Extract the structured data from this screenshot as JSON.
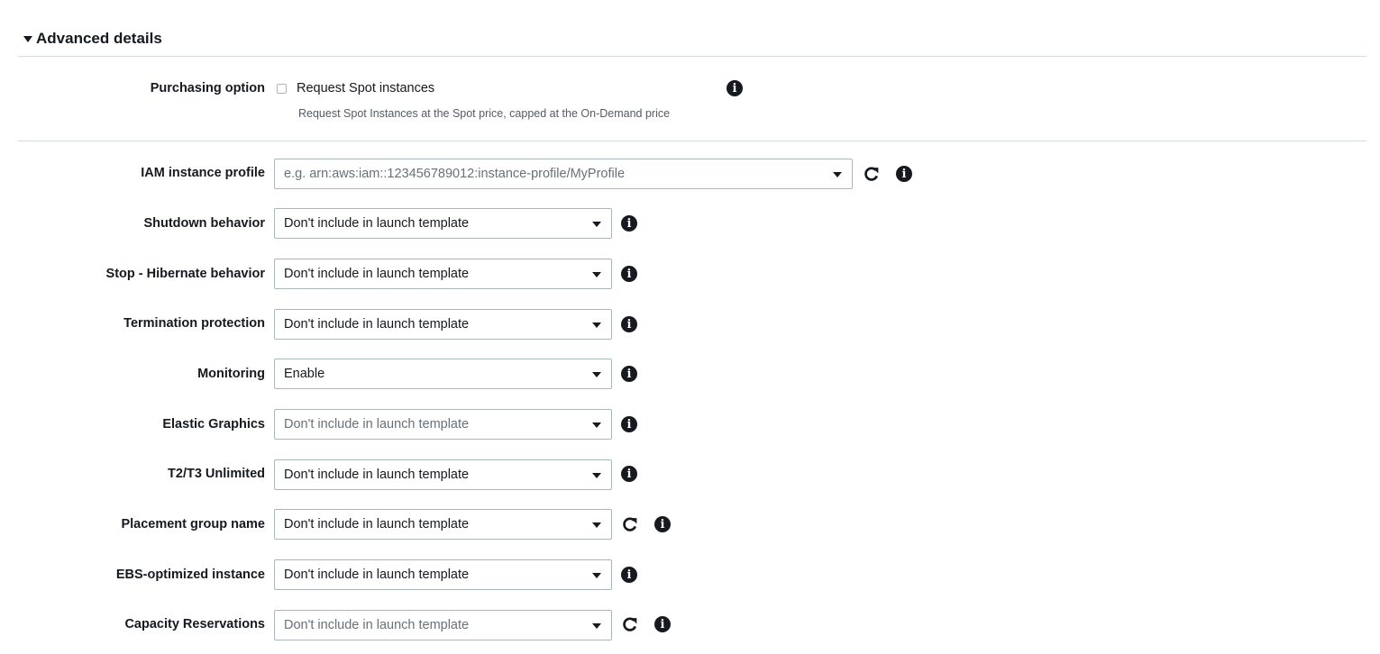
{
  "section": {
    "title": "Advanced details"
  },
  "purchasing": {
    "label": "Purchasing option",
    "checkbox_label": "Request Spot instances",
    "checked": false,
    "help": "Request Spot Instances at the Spot price, capped at the On-Demand price"
  },
  "fields": {
    "iam": {
      "label": "IAM instance profile",
      "placeholder": "e.g. arn:aws:iam::123456789012:instance-profile/MyProfile"
    },
    "shutdown": {
      "label": "Shutdown behavior",
      "value": "Don't include in launch template"
    },
    "hibernate": {
      "label": "Stop - Hibernate behavior",
      "value": "Don't include in launch template"
    },
    "termination": {
      "label": "Termination protection",
      "value": "Don't include in launch template"
    },
    "monitoring": {
      "label": "Monitoring",
      "value": "Enable"
    },
    "elastic_graphics": {
      "label": "Elastic Graphics",
      "placeholder": "Don't include in launch template"
    },
    "t2t3": {
      "label": "T2/T3 Unlimited",
      "value": "Don't include in launch template"
    },
    "placement_group": {
      "label": "Placement group name",
      "value": "Don't include in launch template"
    },
    "ebs_optimized": {
      "label": "EBS-optimized instance",
      "value": "Don't include in launch template"
    },
    "capacity_reservations": {
      "label": "Capacity Reservations",
      "placeholder": "Don't include in launch template"
    }
  },
  "icons": {
    "info": "info-icon",
    "refresh": "refresh-icon",
    "caret": "caret-down-icon",
    "info_glyph": "i"
  },
  "colors": {
    "text": "#16191f",
    "muted": "#545b64",
    "placeholder": "#687078",
    "border": "#aab7b8",
    "divider": "#d5dbdb"
  }
}
